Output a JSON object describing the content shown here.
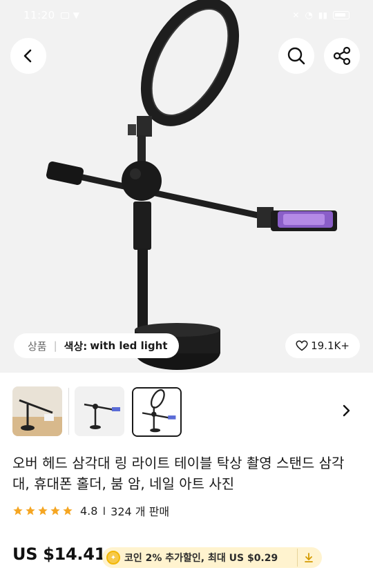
{
  "status_bar": {
    "time": "11:20"
  },
  "hero": {
    "variant_tag": "상품",
    "variant_prefix": "색상:",
    "variant_value": "with led light",
    "wishlist_count": "19.1K+"
  },
  "thumbnails": [
    "thumb-lifestyle",
    "thumb-stand-phone",
    "thumb-stand-ring-light"
  ],
  "product": {
    "title": "오버 헤드 삼각대 링 라이트 테이블 탁상 촬영 스탠드 삼각대, 휴대폰 홀더, 붐 암, 네일 아트 사진",
    "rating": "4.8",
    "rating_sep": "I",
    "sold": "324 개 판매",
    "stars": 5,
    "price": "US $14.41",
    "coin_text": "코인 2% 추가할인, 최대 US $0.29"
  },
  "colors": {
    "coin_bg": "#fff3cf",
    "star": "#f5a623",
    "coin": "#f7c948"
  },
  "icons": [
    "back-icon",
    "search-icon",
    "share-icon",
    "heart-icon",
    "chevron-right-icon",
    "coin-icon",
    "download-icon"
  ]
}
